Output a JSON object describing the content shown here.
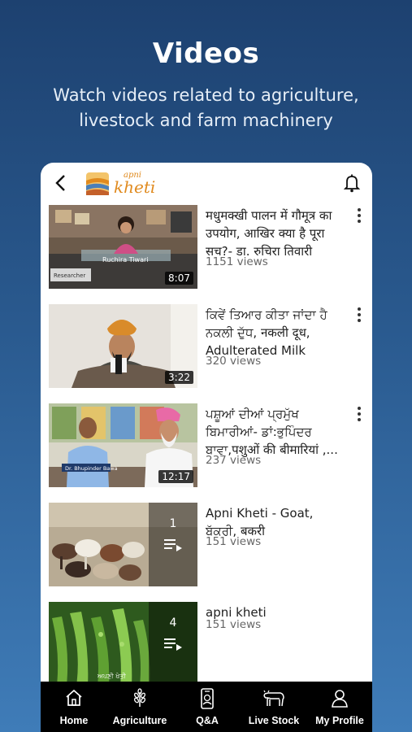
{
  "promo": {
    "title": "Videos",
    "subtitle": "Watch videos related to agriculture, livestock and farm machinery"
  },
  "app": {
    "logo_small": "apni",
    "logo_big": "kheti",
    "back_icon": "back-arrow-icon",
    "notification_icon": "bell-icon"
  },
  "videos": [
    {
      "title": "मधुमक्खी पालन में गौमूत्र का उपयोग, आखिर क्या है पूरा सच?- डा. रुचिरा तिवारी",
      "views": "1151 views",
      "duration": "8:07",
      "thumb_caption": "Ruchira Tiwari",
      "thumb_caption2": "Researcher"
    },
    {
      "title": "ਕਿਵੇਂ ਤਿਆਰ ਕੀਤਾ ਜਾਂਦਾ ਹੈ ਨਕਲੀ ਦੁੱਧ, नकली दूध, Adulterated Milk",
      "views": "320 views",
      "duration": "3:22"
    },
    {
      "title": "ਪਸ਼ੂਆਂ ਦੀਆਂ ਪ੍ਰਮੁੱਖ ਬਿਮਾਰੀਆਂ- ਡਾਂ:ਭੁਪਿੰਦਰ ਬਾਵਾ,पशुओं की बीमारियां ,...",
      "views": "237 views",
      "duration": "12:17",
      "thumb_caption": "Dr. Bhupinder Bawa"
    },
    {
      "title": "Apni Kheti - Goat, ਬੱਕਰੀ, बकरी",
      "views": "151 views",
      "playlist_count": "1"
    },
    {
      "title": "apni kheti",
      "views": "151 views",
      "playlist_count": "4",
      "thumb_caption": "ਅਪਣੀ ਖੇਤੀ"
    }
  ],
  "nav": [
    {
      "label": "Home",
      "icon": "home-icon"
    },
    {
      "label": "Agriculture",
      "icon": "wheat-icon"
    },
    {
      "label": "Q&A",
      "icon": "qa-phone-icon"
    },
    {
      "label": "Live Stock",
      "icon": "cow-icon"
    },
    {
      "label": "My Profile",
      "icon": "profile-icon"
    }
  ],
  "colors": {
    "brand_orange": "#e08a1e",
    "nav_bg": "#000000",
    "bg_top": "#1d4170",
    "bg_bottom": "#3f7cb8"
  }
}
